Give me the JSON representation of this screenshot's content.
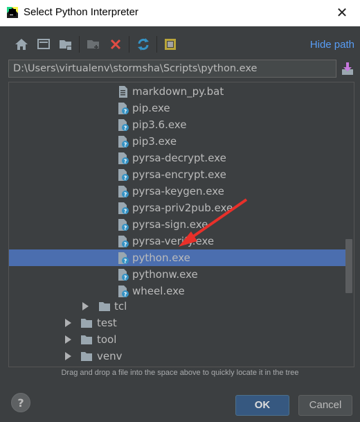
{
  "window": {
    "title": "Select Python Interpreter"
  },
  "toolbar": {
    "hide_path_label": "Hide path"
  },
  "path": {
    "value": "D:\\Users\\virtualenv\\stormsha\\Scripts\\python.exe"
  },
  "tree": {
    "items": [
      {
        "label": "markdown_py.bat",
        "type": "file"
      },
      {
        "label": "pip.exe",
        "type": "exe"
      },
      {
        "label": "pip3.6.exe",
        "type": "exe"
      },
      {
        "label": "pip3.exe",
        "type": "exe"
      },
      {
        "label": "pyrsa-decrypt.exe",
        "type": "exe"
      },
      {
        "label": "pyrsa-encrypt.exe",
        "type": "exe"
      },
      {
        "label": "pyrsa-keygen.exe",
        "type": "exe"
      },
      {
        "label": "pyrsa-priv2pub.exe",
        "type": "exe"
      },
      {
        "label": "pyrsa-sign.exe",
        "type": "exe"
      },
      {
        "label": "pyrsa-verify.exe",
        "type": "exe"
      },
      {
        "label": "python.exe",
        "type": "exe",
        "selected": true
      },
      {
        "label": "pythonw.exe",
        "type": "exe"
      },
      {
        "label": "wheel.exe",
        "type": "exe"
      },
      {
        "label": "tcl",
        "type": "folder"
      },
      {
        "label": "test",
        "type": "folder"
      },
      {
        "label": "tool",
        "type": "folder"
      },
      {
        "label": "venv",
        "type": "folder"
      }
    ]
  },
  "hint": "Drag and drop a file into the space above to quickly locate it in the tree",
  "buttons": {
    "help": "?",
    "ok": "OK",
    "cancel": "Cancel"
  },
  "colors": {
    "accent": "#589df6",
    "selection": "#4b6eaf",
    "annotation_arrow": "#e8302a"
  }
}
